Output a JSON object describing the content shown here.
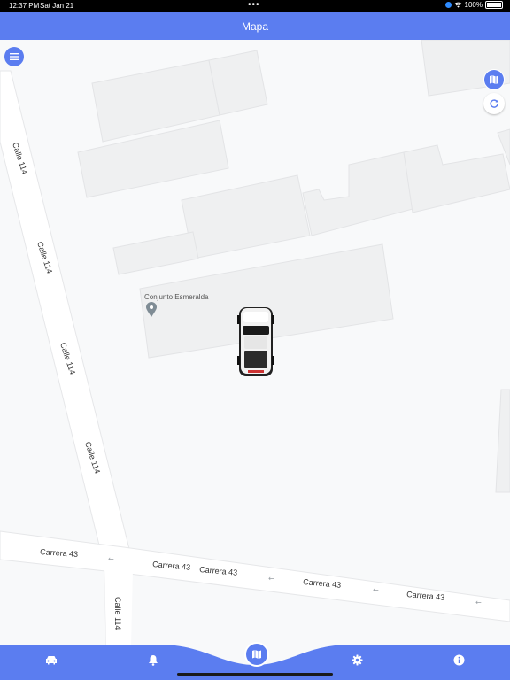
{
  "status_bar": {
    "time": "12:37 PM",
    "date": "Sat Jan 21",
    "battery": "100%",
    "icons": [
      "location-icon",
      "wifi-icon",
      "battery-icon"
    ]
  },
  "header": {
    "title": "Mapa"
  },
  "map": {
    "streets": {
      "vertical": [
        "Calle 114",
        "Calle 114",
        "Calle 114",
        "Calle 114",
        "Calle 114"
      ],
      "horizontal": [
        "Carrera 43",
        "Carrera 43",
        "Carrera 43",
        "Carrera 43",
        "Carrera 43"
      ]
    },
    "poi": {
      "name": "Conjunto Esmeralda",
      "icon": "place-pin-icon"
    },
    "vehicle": {
      "icon": "pickup-truck-icon"
    }
  },
  "controls": {
    "menu_icon": "menu-icon",
    "map_icon": "map-icon",
    "refresh_icon": "refresh-icon"
  },
  "bottom_nav": {
    "items": [
      {
        "icon": "car-icon"
      },
      {
        "icon": "bell-icon"
      },
      {
        "icon": "map-icon"
      },
      {
        "icon": "gear-icon"
      },
      {
        "icon": "info-icon"
      }
    ],
    "active_index": 2
  },
  "colors": {
    "accent": "#5b7df0",
    "map_background": "#f8f9fa",
    "building_fill": "#eff0f1",
    "road": "#ffffff",
    "status_bar": "#000000"
  }
}
